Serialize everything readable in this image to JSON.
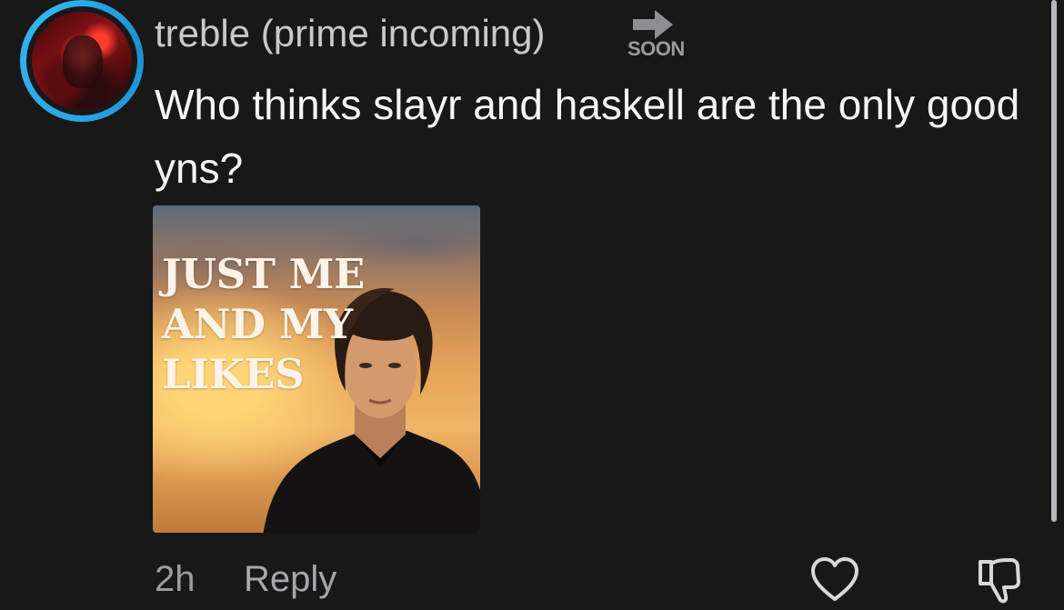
{
  "comment": {
    "username": "treble (prime incoming)",
    "badge_text": "SOON",
    "text": "Who thinks slayr and haskell are the only good yns?",
    "attachment": {
      "title_lines": [
        "JUST ME",
        "AND MY",
        "LIKES"
      ]
    },
    "timestamp": "2h",
    "reply_label": "Reply",
    "icons": {
      "like": "heart-outline-icon",
      "dislike": "thumbs-down-outline-icon",
      "badge": "arrow-right-icon"
    }
  },
  "colors": {
    "avatar_ring": "#2aa9e6",
    "background": "#181819"
  }
}
